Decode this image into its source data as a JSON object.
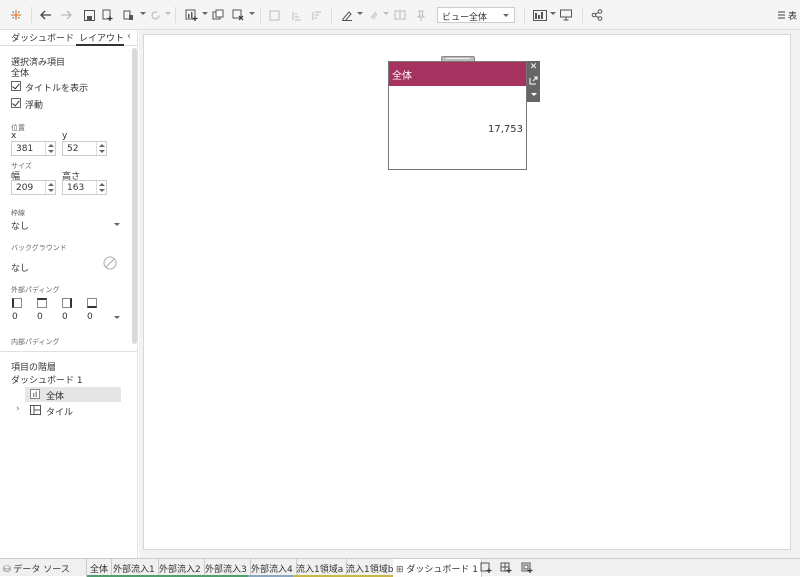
{
  "toolbar": {
    "view_select": "ビュー全体",
    "right_label": "表"
  },
  "left_panel": {
    "tabs": [
      "ダッシュボード",
      "レイアウト"
    ],
    "selected_section_title": "選択済み項目",
    "selected_item": "全体",
    "show_title_label": "タイトルを表示",
    "floating_label": "浮動",
    "position_label": "位置",
    "x_label": "x",
    "y_label": "y",
    "x_value": "381",
    "y_value": "52",
    "size_label": "サイズ",
    "width_label": "幅",
    "height_label": "高さ",
    "width_value": "209",
    "height_value": "163",
    "border_label": "枠線",
    "border_value": "なし",
    "background_label": "バックグラウンド",
    "background_value": "なし",
    "outer_padding_label": "外部パディング",
    "padding_values": [
      "0",
      "0",
      "0",
      "0"
    ],
    "inner_padding_label": "内部パディング",
    "hierarchy_title": "項目の階層",
    "hierarchy_root": "ダッシュボード 1",
    "hierarchy_items": [
      "全体",
      "タイル"
    ]
  },
  "floating_object": {
    "title": "全体",
    "value": "17,753",
    "title_color": "#a6325f"
  },
  "bottom_tabs": {
    "datasource": "データ ソース",
    "sheets": [
      "全体",
      "外部流入1",
      "外部流入2",
      "外部流入3",
      "外部流入4",
      "流入1領域a",
      "流入1領域b"
    ],
    "dashboard": "ダッシュボード 1"
  }
}
